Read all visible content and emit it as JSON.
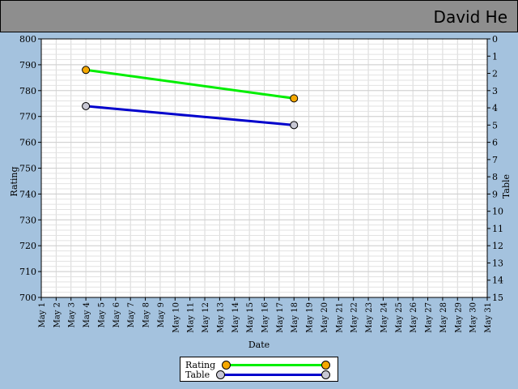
{
  "header": {
    "player_name": "David He"
  },
  "chart_data": {
    "type": "line",
    "xlabel": "Date",
    "ylabel": "Rating",
    "y2label": "Table",
    "x_categories": [
      "May 1",
      "May 2",
      "May 3",
      "May 4",
      "May 5",
      "May 6",
      "May 7",
      "May 8",
      "May 9",
      "May 10",
      "May 11",
      "May 12",
      "May 13",
      "May 14",
      "May 15",
      "May 16",
      "May 17",
      "May 18",
      "May 19",
      "May 20",
      "May 21",
      "May 22",
      "May 23",
      "May 24",
      "May 25",
      "May 26",
      "May 27",
      "May 28",
      "May 29",
      "May 30",
      "May 31"
    ],
    "ylim": [
      700,
      800
    ],
    "yticks": [
      700,
      710,
      720,
      730,
      740,
      750,
      760,
      770,
      780,
      790,
      800
    ],
    "y2lim": [
      0,
      15
    ],
    "y2ticks": [
      0,
      1,
      2,
      3,
      4,
      5,
      6,
      7,
      8,
      9,
      10,
      11,
      12,
      13,
      14,
      15
    ],
    "y2_inverted": true,
    "grid": true,
    "legend_position": "bottom-center",
    "series": [
      {
        "name": "Rating",
        "axis": "left",
        "color": "#00ee00",
        "marker_color": "#f5a800",
        "points": [
          {
            "x": "May 4",
            "y": 788
          },
          {
            "x": "May 18",
            "y": 777
          }
        ]
      },
      {
        "name": "Table",
        "axis": "right",
        "color": "#0000cc",
        "marker_color": "#c8c8d4",
        "points": [
          {
            "x": "May 4",
            "y": 3.9
          },
          {
            "x": "May 18",
            "y": 5.0
          }
        ]
      }
    ]
  }
}
